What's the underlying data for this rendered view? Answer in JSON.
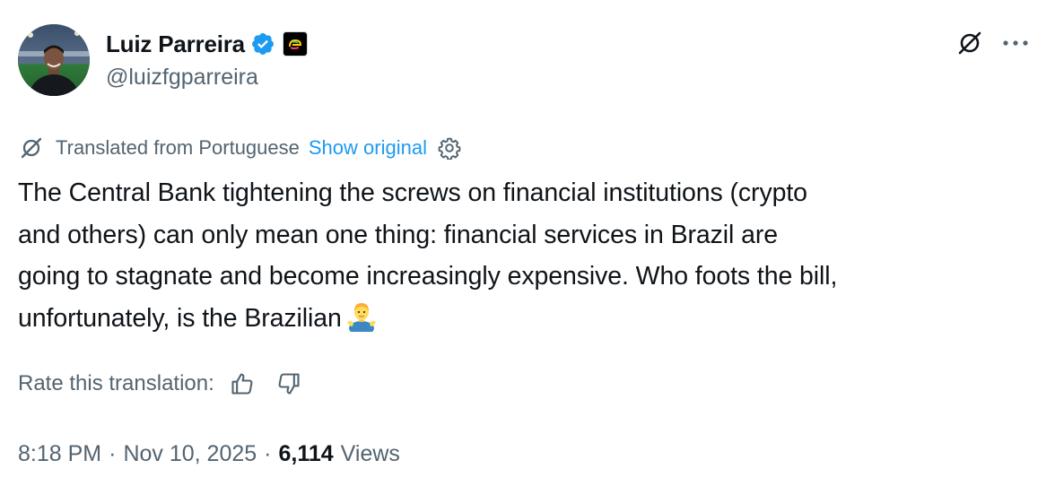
{
  "author": {
    "display_name": "Luiz Parreira",
    "handle": "@luizfgparreira",
    "verified_color": "#1d9bf0"
  },
  "header_icons": {
    "grok": "grok-icon",
    "more": "more-icon"
  },
  "translation": {
    "label": "Translated from Portuguese",
    "show_original": "Show original",
    "link_color": "#1d9bf0"
  },
  "tweet": {
    "lines": [
      "The Central Bank tightening the screws on financial institutions (crypto",
      "and others) can only mean one thing: financial services in Brazil are",
      "going to stagnate and become increasingly expensive. Who foots the bill,",
      "unfortunately, is the Brazilian"
    ],
    "emoji": "person-shrugging-emoji"
  },
  "rate": {
    "label": "Rate this translation:"
  },
  "meta": {
    "time": "8:18 PM",
    "separator": "·",
    "date": "Nov 10, 2025",
    "views_count": "6,114",
    "views_label": "Views"
  },
  "colors": {
    "text": "#0f1419",
    "secondary": "#536471",
    "accent": "#1d9bf0"
  }
}
